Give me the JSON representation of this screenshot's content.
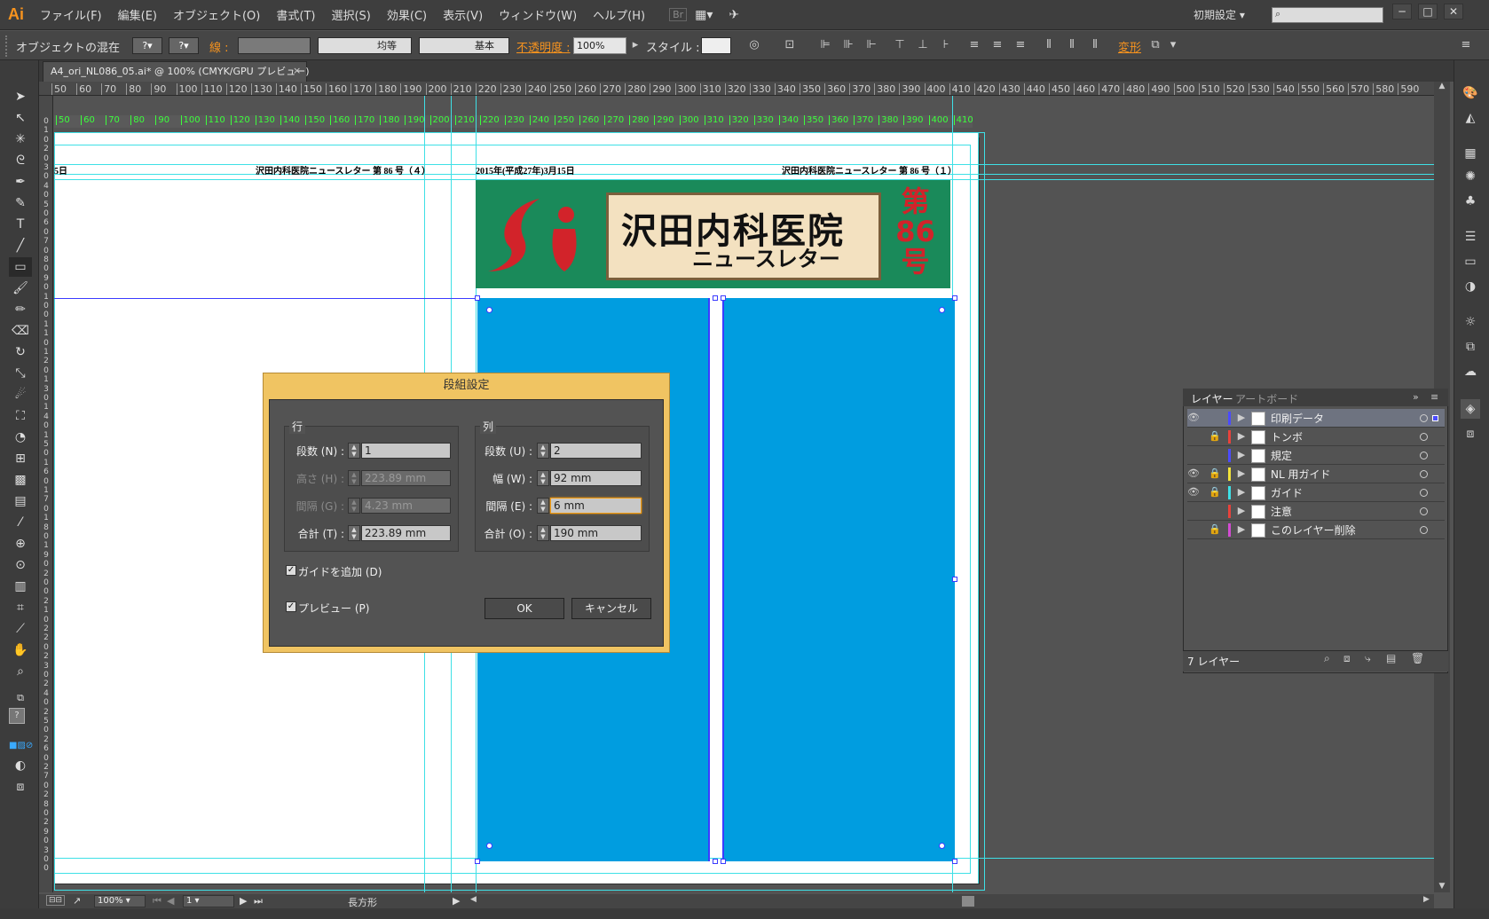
{
  "app": {
    "logo": "Ai",
    "workspace": "初期設定",
    "search_placeholder": ""
  },
  "menu": [
    "ファイル(F)",
    "編集(E)",
    "オブジェクト(O)",
    "書式(T)",
    "選択(S)",
    "効果(C)",
    "表示(V)",
    "ウィンドウ(W)",
    "ヘルプ(H)"
  ],
  "window_buttons": [
    "─",
    "□",
    "✕"
  ],
  "controlbar": {
    "object_label": "オブジェクトの混在",
    "stroke_label": "線 :",
    "stroke_style_1": "均等",
    "stroke_style_2": "基本",
    "opacity_label": "不透明度 :",
    "opacity_value": "100%",
    "style_label": "スタイル :",
    "transform_label": "変形"
  },
  "document": {
    "tab_title": "A4_ori_NL086_05.ai* @ 100% (CMYK/GPU プレビュー)",
    "close": "×"
  },
  "rulers": {
    "top": [
      "50",
      "60",
      "70",
      "80",
      "90",
      "100",
      "110",
      "120",
      "130",
      "140",
      "150",
      "160",
      "170",
      "180",
      "190",
      "200",
      "210",
      "220",
      "230",
      "240",
      "250",
      "260",
      "270",
      "280",
      "290",
      "300",
      "310",
      "320",
      "330",
      "340",
      "350",
      "360",
      "370",
      "380",
      "390",
      "400",
      "410",
      "420",
      "430",
      "440",
      "450",
      "460",
      "470",
      "480",
      "490",
      "500",
      "510",
      "520",
      "530",
      "540",
      "550",
      "560",
      "570",
      "580",
      "590"
    ],
    "green": [
      "50",
      "60",
      "70",
      "80",
      "90",
      "100",
      "110",
      "120",
      "130",
      "140",
      "150",
      "160",
      "170",
      "180",
      "190",
      "200",
      "210",
      "220",
      "230",
      "240",
      "250",
      "260",
      "270",
      "280",
      "290",
      "300",
      "310",
      "320",
      "330",
      "340",
      "350",
      "360",
      "370",
      "380",
      "390",
      "400",
      "410"
    ],
    "left": [
      "0",
      "1",
      "0",
      "2",
      "0",
      "3",
      "0",
      "4",
      "0",
      "5",
      "0",
      "6",
      "0",
      "7",
      "0",
      "8",
      "0",
      "9",
      "0",
      "1",
      "0",
      "0",
      "1",
      "1",
      "0",
      "1",
      "2",
      "0",
      "1",
      "3",
      "0",
      "1",
      "4",
      "0",
      "1",
      "5",
      "0",
      "1",
      "6",
      "0",
      "1",
      "7",
      "0",
      "1",
      "8",
      "0",
      "1",
      "9",
      "0",
      "2",
      "0",
      "0",
      "2",
      "1",
      "0",
      "2",
      "2",
      "0",
      "2",
      "3",
      "0",
      "2",
      "4",
      "0",
      "2",
      "5",
      "0",
      "2",
      "6",
      "0",
      "2",
      "7",
      "0",
      "2",
      "8",
      "0",
      "2",
      "9",
      "0",
      "3",
      "0",
      "0"
    ]
  },
  "artwork": {
    "header_left_date": "5日",
    "header_left_title": "沢田内科医院ニュースレター 第 86 号（４）",
    "header_right_date": "2015年(平成27年)3月15日",
    "header_right_title": "沢田内科医院ニュースレター 第 86 号（１）",
    "banner_title": "沢田内科医院",
    "banner_subtitle": "ニュースレター",
    "banner_issue_1": "第",
    "banner_issue_2": "86",
    "banner_issue_3": "号",
    "banner_logo": "Si"
  },
  "dialog": {
    "title": "段組設定",
    "rows_legend": "行",
    "cols_legend": "列",
    "rows": {
      "count_label": "段数 (N) :",
      "count_value": "1",
      "height_label": "高さ (H) :",
      "height_value": "223.89 mm",
      "gutter_label": "間隔 (G) :",
      "gutter_value": "4.23 mm",
      "total_label": "合計 (T) :",
      "total_value": "223.89 mm"
    },
    "cols": {
      "count_label": "段数 (U) :",
      "count_value": "2",
      "width_label": "幅 (W) :",
      "width_value": "92 mm",
      "gutter_label": "間隔 (E) :",
      "gutter_value": "6 mm",
      "total_label": "合計 (O) :",
      "total_value": "190 mm"
    },
    "add_guides_label": "ガイドを追加 (D)",
    "preview_label": "プレビュー (P)",
    "ok_label": "OK",
    "cancel_label": "キャンセル"
  },
  "layers_panel": {
    "tab_layers": "レイヤー",
    "tab_artboards": "アートボード",
    "layers": [
      {
        "name": "印刷データ",
        "color": "#4b4bff",
        "visible": true,
        "locked": false
      },
      {
        "name": "トンボ",
        "color": "#e8423b",
        "visible": false,
        "locked": true
      },
      {
        "name": "規定",
        "color": "#4b4bff",
        "visible": false,
        "locked": false
      },
      {
        "name": "NL 用ガイド",
        "color": "#f2e33a",
        "visible": true,
        "locked": true
      },
      {
        "name": "ガイド",
        "color": "#3ee0e6",
        "visible": true,
        "locked": true
      },
      {
        "name": "注意",
        "color": "#e8423b",
        "visible": false,
        "locked": false
      },
      {
        "name": "このレイヤー削除",
        "color": "#d24bd2",
        "visible": false,
        "locked": true
      }
    ],
    "count_label": "7 レイヤー"
  },
  "statusbar": {
    "zoom": "100%",
    "artboard": "1",
    "tool_name": "長方形"
  },
  "colors": {
    "accent": "#f7931e",
    "dialog_frame": "#f0c462",
    "column_fill": "#009de0",
    "guide": "#3ee0e6",
    "banner_green": "#1a8a5a"
  }
}
